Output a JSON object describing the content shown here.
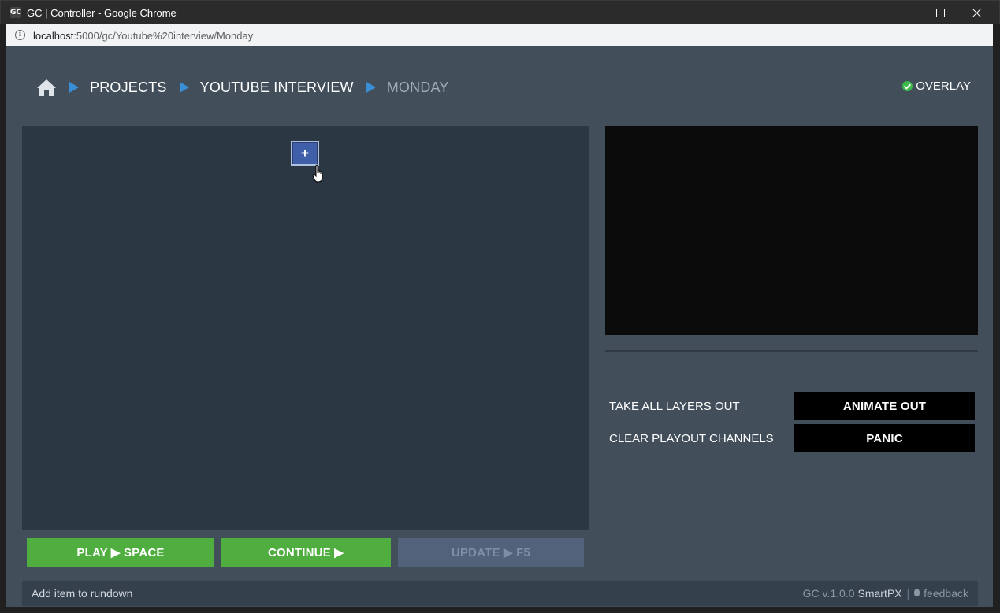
{
  "window": {
    "title": "GC | Controller - Google Chrome",
    "app_icon_text": "GC"
  },
  "address": {
    "host": "localhost",
    "path": ":5000/gc/Youtube%20interview/Monday"
  },
  "breadcrumb": {
    "items": [
      "PROJECTS",
      "YOUTUBE INTERVIEW",
      "MONDAY"
    ]
  },
  "status": {
    "overlay_label": "OVERLAY",
    "overlay_color": "#3cb94b"
  },
  "rundown": {
    "add_label": "+"
  },
  "controls": {
    "take_all_label": "TAKE ALL LAYERS OUT",
    "animate_out": "ANIMATE OUT",
    "clear_label": "CLEAR PLAYOUT CHANNELS",
    "panic": "PANIC"
  },
  "playout": {
    "play": "PLAY ▶ SPACE",
    "continue": "CONTINUE ▶",
    "update": "UPDATE ▶ F5"
  },
  "footer": {
    "hint": "Add item to rundown",
    "version": "GC v.1.0.0",
    "brand": "SmartPX",
    "separator": "|",
    "feedback": "feedback"
  },
  "colors": {
    "accent_green": "#4fae3f",
    "breadcrumb_arrow": "#3a8ed6",
    "app_bg": "#424f5b"
  }
}
